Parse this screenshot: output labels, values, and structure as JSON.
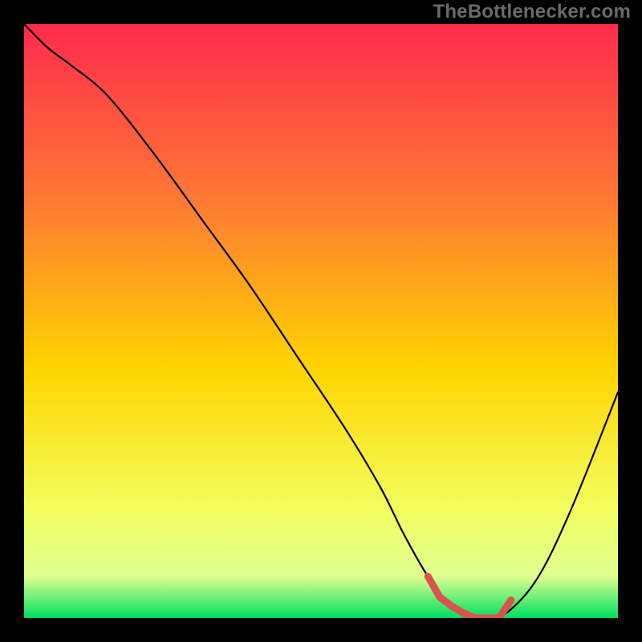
{
  "watermark": "TheBottlenecker.com",
  "colors": {
    "page_bg": "#000000",
    "watermark": "#6a6a6a",
    "gradient": {
      "top": "#ff2a4d",
      "upper_mid": "#ff7a33",
      "mid": "#ffd400",
      "lower_mid": "#f3ff60",
      "near_bottom": "#dfff90",
      "bottom": "#00e060"
    },
    "curve": "#000000",
    "optimal_marker": "#d9534f"
  },
  "chart_data": {
    "type": "line",
    "title": "",
    "xlabel": "",
    "ylabel": "",
    "xlim": [
      0,
      100
    ],
    "ylim": [
      0,
      100
    ],
    "x": [
      0,
      4,
      8,
      14,
      22,
      30,
      38,
      46,
      54,
      60,
      64,
      68,
      72,
      76,
      80,
      86,
      92,
      100
    ],
    "values": [
      100,
      96,
      93,
      88,
      78,
      67,
      56,
      44,
      32,
      22,
      14,
      7,
      2,
      0,
      0,
      6,
      18,
      38
    ],
    "optimal_range_x": [
      68,
      82
    ],
    "optimal_band_curve": [
      {
        "x": 68,
        "y": 7
      },
      {
        "x": 70,
        "y": 3.5
      },
      {
        "x": 72,
        "y": 2
      },
      {
        "x": 74,
        "y": 0.8
      },
      {
        "x": 76,
        "y": 0
      },
      {
        "x": 78,
        "y": 0
      },
      {
        "x": 80,
        "y": 0
      },
      {
        "x": 82,
        "y": 3
      }
    ]
  }
}
